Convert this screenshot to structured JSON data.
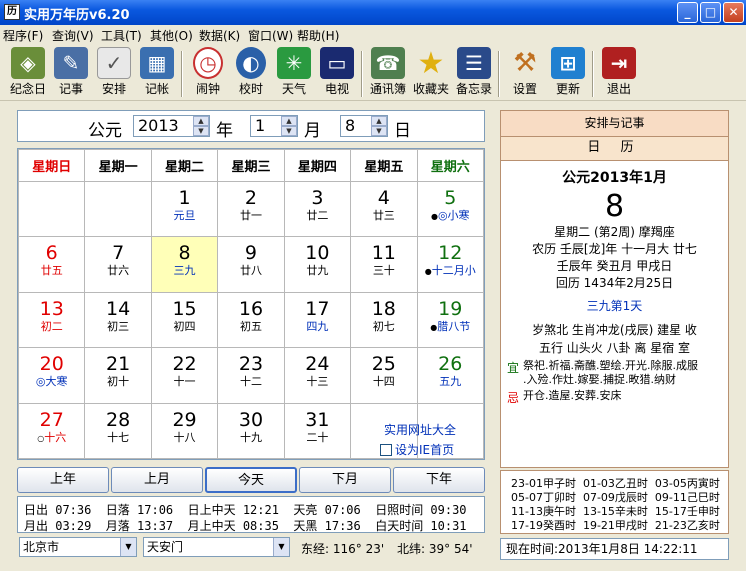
{
  "window": {
    "title": "实用万年历v6.20",
    "btn_min": "_",
    "btn_max": "□",
    "btn_close": "✕"
  },
  "menu": [
    "程序(F)",
    "查询(V)",
    "工具(T)",
    "其他(O)",
    "数据(K)",
    "窗口(W)",
    "帮助(H)"
  ],
  "toolbar": [
    {
      "label": "纪念日",
      "icon": "anniversary-icon",
      "color": "#6a8e3a"
    },
    {
      "label": "记事",
      "icon": "note-icon",
      "color": "#4a6fa5"
    },
    {
      "label": "安排",
      "icon": "schedule-icon",
      "color": "#8a8a8a"
    },
    {
      "label": "记帐",
      "icon": "ledger-icon",
      "color": "#3a6fb0"
    },
    {
      "label": "闹钟",
      "icon": "alarm-icon",
      "color": "#c83030"
    },
    {
      "label": "校时",
      "icon": "sync-time-icon",
      "color": "#2a60a8"
    },
    {
      "label": "天气",
      "icon": "weather-icon",
      "color": "#2a9a40"
    },
    {
      "label": "电视",
      "icon": "tv-icon",
      "color": "#1a2a70"
    },
    {
      "label": "通讯簿",
      "icon": "address-book-icon",
      "color": "#4f7f4f"
    },
    {
      "label": "收藏夹",
      "icon": "favorites-icon",
      "color": "#e0b010"
    },
    {
      "label": "备忘录",
      "icon": "memo-icon",
      "color": "#2a4a8a"
    },
    {
      "label": "设置",
      "icon": "settings-icon",
      "color": "#c07020"
    },
    {
      "label": "更新",
      "icon": "update-icon",
      "color": "#2080d0"
    },
    {
      "label": "退出",
      "icon": "exit-icon",
      "color": "#b02020"
    }
  ],
  "datebar": {
    "era": "公元",
    "year": "2013",
    "year_unit": "年",
    "month": "1",
    "month_unit": "月",
    "day": "8",
    "day_unit": "日"
  },
  "weekdays": [
    "星期日",
    "星期一",
    "星期二",
    "星期三",
    "星期四",
    "星期五",
    "星期六"
  ],
  "calendar_rows": [
    [
      {
        "d": "",
        "l": ""
      },
      {
        "d": "",
        "l": ""
      },
      {
        "d": "1",
        "l": "元旦",
        "lc": "blue"
      },
      {
        "d": "2",
        "l": "廿一"
      },
      {
        "d": "3",
        "l": "廿二"
      },
      {
        "d": "4",
        "l": "廿三"
      },
      {
        "d": "5",
        "l": "◎小寒",
        "dc": "green",
        "lc": "blue",
        "mark": "●"
      }
    ],
    [
      {
        "d": "6",
        "l": "廿五",
        "dc": "red",
        "lc": "red"
      },
      {
        "d": "7",
        "l": "廿六"
      },
      {
        "d": "8",
        "l": "三九",
        "lc": "blue",
        "today": true
      },
      {
        "d": "9",
        "l": "廿八"
      },
      {
        "d": "10",
        "l": "廿九"
      },
      {
        "d": "11",
        "l": "三十"
      },
      {
        "d": "12",
        "l": "十二月小",
        "dc": "green",
        "lc": "blue",
        "mark": "●"
      }
    ],
    [
      {
        "d": "13",
        "l": "初二",
        "dc": "red",
        "lc": "red"
      },
      {
        "d": "14",
        "l": "初三"
      },
      {
        "d": "15",
        "l": "初四"
      },
      {
        "d": "16",
        "l": "初五"
      },
      {
        "d": "17",
        "l": "四九",
        "lc": "blue"
      },
      {
        "d": "18",
        "l": "初七"
      },
      {
        "d": "19",
        "l": "腊八节",
        "dc": "green",
        "lc": "blue",
        "mark": "●"
      }
    ],
    [
      {
        "d": "20",
        "l": "◎大寒",
        "dc": "red",
        "lc": "blue"
      },
      {
        "d": "21",
        "l": "初十"
      },
      {
        "d": "22",
        "l": "十一"
      },
      {
        "d": "23",
        "l": "十二"
      },
      {
        "d": "24",
        "l": "十三"
      },
      {
        "d": "25",
        "l": "十四"
      },
      {
        "d": "26",
        "l": "五九",
        "dc": "green",
        "lc": "blue"
      }
    ],
    [
      {
        "d": "27",
        "l": "十六",
        "dc": "red",
        "lc": "red",
        "mark": "○"
      },
      {
        "d": "28",
        "l": "十七"
      },
      {
        "d": "29",
        "l": "十八"
      },
      {
        "d": "30",
        "l": "十九"
      },
      {
        "d": "31",
        "l": "二十"
      },
      {
        "d": "",
        "l": ""
      },
      {
        "d": "",
        "l": ""
      }
    ]
  ],
  "links": {
    "site": "实用网址大全",
    "ie": "设为IE首页"
  },
  "nav": {
    "prev_year": "上年",
    "prev_month": "上月",
    "today": "今天",
    "next_month": "下月",
    "next_year": "下年"
  },
  "sun": {
    "row1": "日出 07:36  日落 17:06  日上中天 12:21  天亮 07:06  日照时间 09:30",
    "row2": "月出 03:29  月落 13:37  月上中天 08:35  天黑 17:36  白天时间 10:31"
  },
  "location": {
    "city": "北京市",
    "spot": "天安门",
    "lng": "东经: 116° 23'",
    "lat": "北纬: 39° 54'"
  },
  "right": {
    "head1": "安排与记事",
    "head2": "日 历",
    "ym": "公元2013年1月",
    "day": "8",
    "week": "星期二 (第2周) 摩羯座",
    "lunar": "农历 壬辰[龙]年 十一月大 廿七",
    "ganzhi": "壬辰年 癸丑月 甲戌日",
    "hijri": "回历 1434年2月25日",
    "jiu": "三九第1天",
    "r1": "岁煞北 生肖冲龙(戌辰) 建星 收",
    "r2": "五行 山头火  八卦 离  星宿 室",
    "yi_label": "宜",
    "yi1": "祭祀.祈福.斋醮.塑绘.开光.除服.成服",
    "yi2": ".入殓.作灶.嫁娶.捕捉.畋猎.纳财",
    "ji_label": "忌",
    "ji": "开仓.造屋.安葬.安床"
  },
  "hours": [
    "23-01甲子时  01-03乙丑时  03-05丙寅时",
    "05-07丁卯时  07-09戊辰时  09-11己巳时",
    "11-13庚午时  13-15辛未时  15-17壬申时",
    "17-19癸酉时  19-21甲戌时  21-23乙亥时"
  ],
  "current_time": "现在时间:2013年1月8日  14:22:11"
}
